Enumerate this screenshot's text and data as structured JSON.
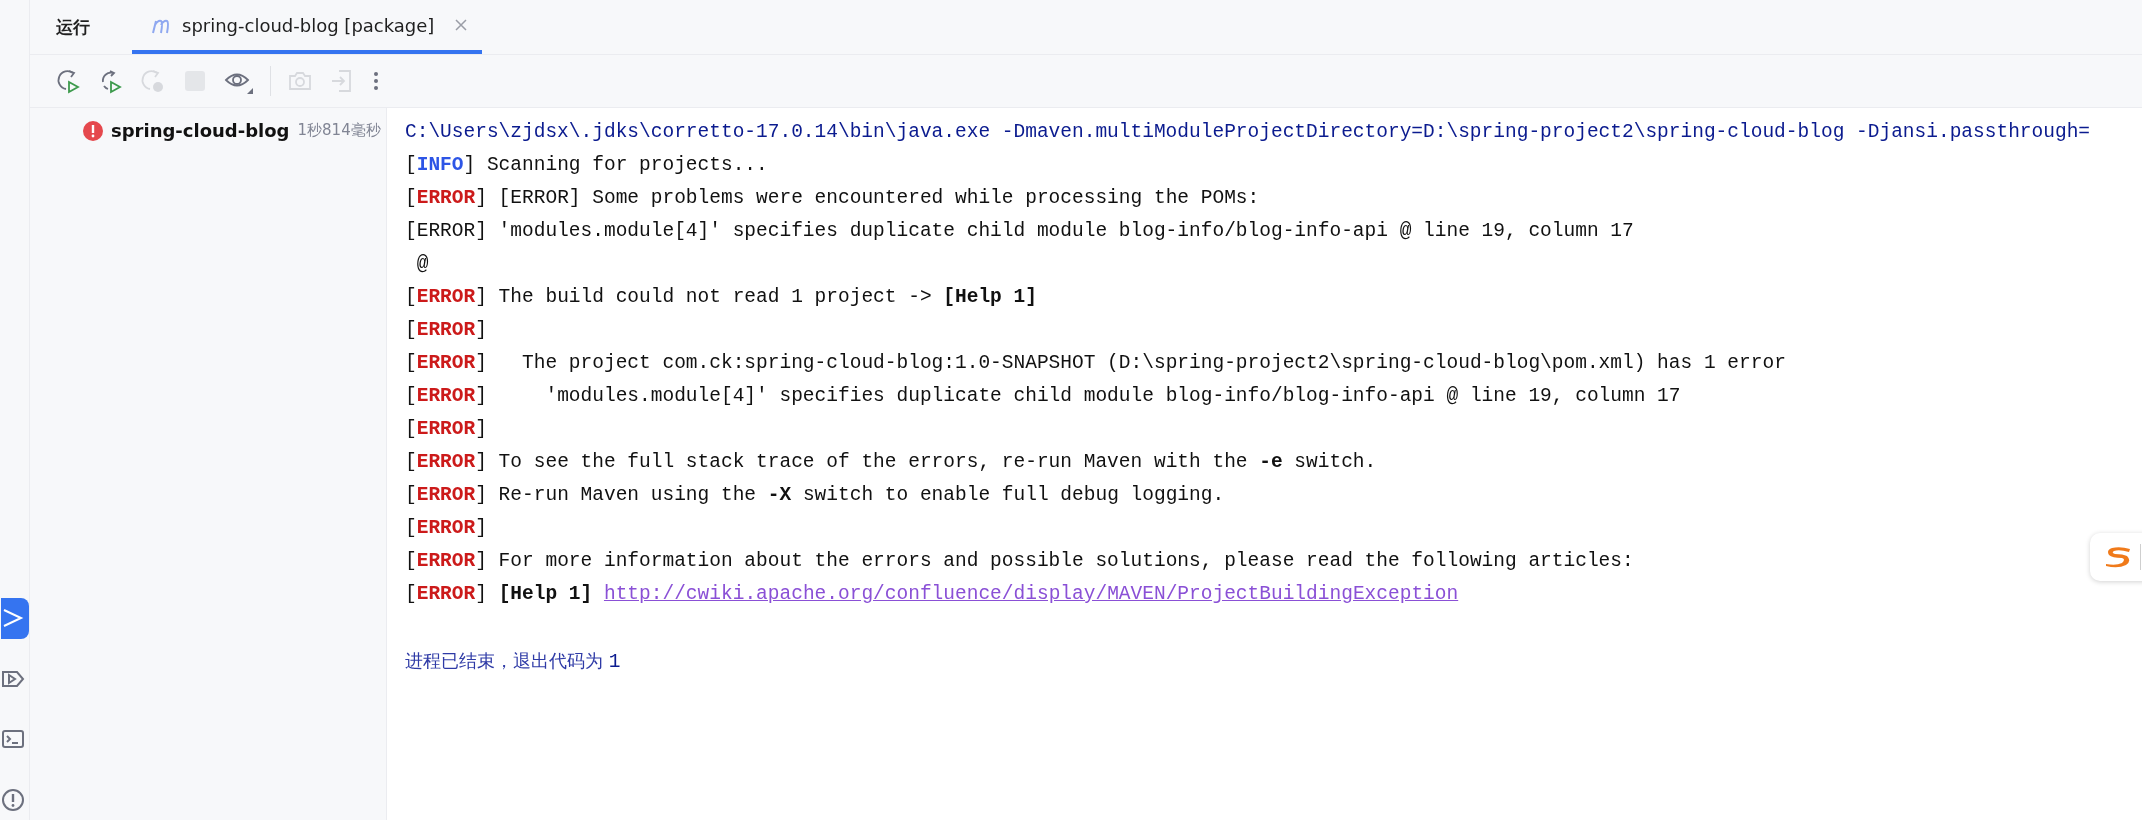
{
  "side_strip": [
    {
      "kind": "run",
      "selected": true
    },
    {
      "kind": "services",
      "selected": false
    },
    {
      "kind": "terminal",
      "selected": false
    },
    {
      "kind": "problems",
      "selected": false
    }
  ],
  "tool_window": {
    "title": "运行"
  },
  "tabs": [
    {
      "label": "spring-cloud-blog [package]",
      "selected": true
    }
  ],
  "toolbar": [
    {
      "kind": "rerun",
      "disabled": false
    },
    {
      "kind": "rerun_failed",
      "disabled": false
    },
    {
      "kind": "rerun_disabled",
      "disabled": true
    },
    {
      "kind": "stop",
      "disabled": true
    },
    {
      "kind": "eye",
      "disabled": false
    },
    {
      "kind": "divider"
    },
    {
      "kind": "camera",
      "disabled": true
    },
    {
      "kind": "exit",
      "disabled": true
    },
    {
      "kind": "more",
      "disabled": false
    }
  ],
  "run_tree": [
    {
      "label": "spring-cloud-blog",
      "kind": "error",
      "duration": "1秒814毫秒"
    }
  ],
  "console": [
    {
      "kind": "text",
      "segments": [
        {
          "kind": "cmd",
          "text": "C:\\Users\\zjdsx\\.jdks\\corretto-17.0.14\\bin\\java.exe -Dmaven.multiModuleProjectDirectory=D:\\spring-project2\\spring-cloud-blog -Djansi.passthrough="
        }
      ]
    },
    {
      "kind": "text",
      "segments": [
        {
          "kind": "plain",
          "text": "["
        },
        {
          "kind": "info",
          "text": "INFO"
        },
        {
          "kind": "plain",
          "text": "] Scanning for projects..."
        }
      ]
    },
    {
      "kind": "text",
      "segments": [
        {
          "kind": "plain",
          "text": "["
        },
        {
          "kind": "error",
          "text": "ERROR"
        },
        {
          "kind": "plain",
          "text": "] [ERROR] Some problems were encountered while processing the POMs:"
        }
      ]
    },
    {
      "kind": "text",
      "segments": [
        {
          "kind": "plain",
          "text": "[ERROR] 'modules.module[4]' specifies duplicate child module blog-info/blog-info-api @ line 19, column 17"
        }
      ]
    },
    {
      "kind": "text",
      "segments": [
        {
          "kind": "plain",
          "text": " @"
        }
      ]
    },
    {
      "kind": "text",
      "segments": [
        {
          "kind": "plain",
          "text": "["
        },
        {
          "kind": "error",
          "text": "ERROR"
        },
        {
          "kind": "plain",
          "text": "] The build could not read 1 project -> "
        },
        {
          "kind": "bold",
          "text": "[Help 1]"
        }
      ]
    },
    {
      "kind": "text",
      "segments": [
        {
          "kind": "plain",
          "text": "["
        },
        {
          "kind": "error",
          "text": "ERROR"
        },
        {
          "kind": "plain",
          "text": "]"
        }
      ]
    },
    {
      "kind": "text",
      "segments": [
        {
          "kind": "plain",
          "text": "["
        },
        {
          "kind": "error",
          "text": "ERROR"
        },
        {
          "kind": "plain",
          "text": "]   The project com.ck:spring-cloud-blog:1.0-SNAPSHOT (D:\\spring-project2\\spring-cloud-blog\\pom.xml) has 1 error"
        }
      ]
    },
    {
      "kind": "text",
      "segments": [
        {
          "kind": "plain",
          "text": "["
        },
        {
          "kind": "error",
          "text": "ERROR"
        },
        {
          "kind": "plain",
          "text": "]     'modules.module[4]' specifies duplicate child module blog-info/blog-info-api @ line 19, column 17"
        }
      ]
    },
    {
      "kind": "text",
      "segments": [
        {
          "kind": "plain",
          "text": "["
        },
        {
          "kind": "error",
          "text": "ERROR"
        },
        {
          "kind": "plain",
          "text": "]"
        }
      ]
    },
    {
      "kind": "text",
      "segments": [
        {
          "kind": "plain",
          "text": "["
        },
        {
          "kind": "error",
          "text": "ERROR"
        },
        {
          "kind": "plain",
          "text": "] To see the full stack trace of the errors, re-run Maven with the "
        },
        {
          "kind": "bold",
          "text": "-e"
        },
        {
          "kind": "plain",
          "text": " switch."
        }
      ]
    },
    {
      "kind": "text",
      "segments": [
        {
          "kind": "plain",
          "text": "["
        },
        {
          "kind": "error",
          "text": "ERROR"
        },
        {
          "kind": "plain",
          "text": "] Re-run Maven using the "
        },
        {
          "kind": "bold",
          "text": "-X"
        },
        {
          "kind": "plain",
          "text": " switch to enable full debug logging."
        }
      ]
    },
    {
      "kind": "text",
      "segments": [
        {
          "kind": "plain",
          "text": "["
        },
        {
          "kind": "error",
          "text": "ERROR"
        },
        {
          "kind": "plain",
          "text": "]"
        }
      ]
    },
    {
      "kind": "text",
      "segments": [
        {
          "kind": "plain",
          "text": "["
        },
        {
          "kind": "error",
          "text": "ERROR"
        },
        {
          "kind": "plain",
          "text": "] For more information about the errors and possible solutions, please read the following articles:"
        }
      ]
    },
    {
      "kind": "text",
      "segments": [
        {
          "kind": "plain",
          "text": "["
        },
        {
          "kind": "error",
          "text": "ERROR"
        },
        {
          "kind": "plain",
          "text": "] "
        },
        {
          "kind": "bold",
          "text": "[Help 1] "
        },
        {
          "kind": "link",
          "text": "http://cwiki.apache.org/confluence/display/MAVEN/ProjectBuildingException"
        }
      ]
    },
    {
      "kind": "blank"
    },
    {
      "kind": "text",
      "segments": [
        {
          "kind": "exit_cjk",
          "text": "进程已结束，退出代码为 "
        },
        {
          "kind": "cmd",
          "text": "1"
        }
      ]
    }
  ]
}
